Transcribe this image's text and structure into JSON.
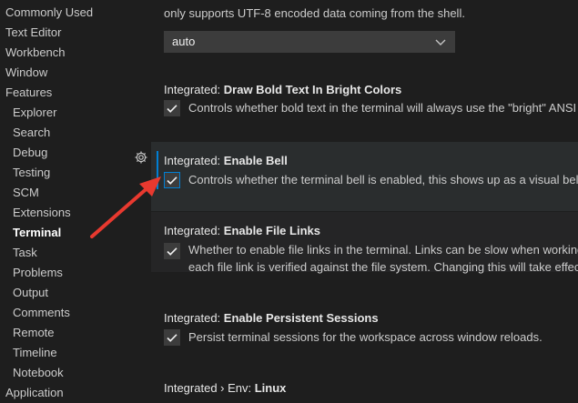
{
  "toc": [
    {
      "label": "Commonly Used",
      "level": 0
    },
    {
      "label": "Text Editor",
      "level": 0
    },
    {
      "label": "Workbench",
      "level": 0
    },
    {
      "label": "Window",
      "level": 0
    },
    {
      "label": "Features",
      "level": 0
    },
    {
      "label": "Explorer",
      "level": 1
    },
    {
      "label": "Search",
      "level": 1
    },
    {
      "label": "Debug",
      "level": 1
    },
    {
      "label": "Testing",
      "level": 1
    },
    {
      "label": "SCM",
      "level": 1
    },
    {
      "label": "Extensions",
      "level": 1
    },
    {
      "label": "Terminal",
      "level": 1,
      "active": true
    },
    {
      "label": "Task",
      "level": 1
    },
    {
      "label": "Problems",
      "level": 1
    },
    {
      "label": "Output",
      "level": 1
    },
    {
      "label": "Comments",
      "level": 1
    },
    {
      "label": "Remote",
      "level": 1
    },
    {
      "label": "Timeline",
      "level": 1
    },
    {
      "label": "Notebook",
      "level": 1
    },
    {
      "label": "Application",
      "level": 0
    }
  ],
  "top_setting": {
    "desc_tail": "only supports UTF-8 encoded data coming from the shell.",
    "dropdown_value": "auto"
  },
  "settings": {
    "bold_bright": {
      "category": "Integrated: ",
      "name": "Draw Bold Text In Bright Colors",
      "desc": "Controls whether bold text in the terminal will always use the \"bright\" ANSI",
      "checked": true
    },
    "enable_bell": {
      "category": "Integrated: ",
      "name": "Enable Bell",
      "desc": "Controls whether the terminal bell is enabled, this shows up as a visual bell",
      "checked": true
    },
    "file_links": {
      "category": "Integrated: ",
      "name": "Enable File Links",
      "desc1": "Whether to enable file links in the terminal. Links can be slow when working",
      "desc2": "each file link is verified against the file system. Changing this will take effec",
      "checked": true
    },
    "persistent": {
      "category": "Integrated: ",
      "name": "Enable Persistent Sessions",
      "desc": "Persist terminal sessions for the workspace across window reloads.",
      "checked": true
    },
    "env_linux": {
      "category": "Integrated › Env: ",
      "name": "Linux"
    }
  },
  "colors": {
    "background": "#1e1e1e",
    "focus": "#007fd4",
    "arrow": "#e8392f"
  },
  "icons": [
    "gear-icon",
    "check-icon",
    "chevron-down-icon",
    "red-arrow-annotation"
  ]
}
